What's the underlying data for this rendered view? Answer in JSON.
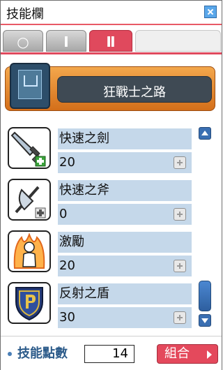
{
  "window": {
    "title": "技能欄"
  },
  "tabs": [
    {
      "glyph": "○",
      "active": false
    },
    {
      "glyph": "Ⅰ",
      "active": false
    },
    {
      "glyph": "Ⅱ",
      "active": true
    },
    {
      "glyph": "",
      "active": false
    }
  ],
  "job": {
    "title": "狂戰士之路",
    "icon": "book-icon"
  },
  "skills": [
    {
      "name": "快速之劍",
      "level": "20",
      "icon": "sword-icon"
    },
    {
      "name": "快速之斧",
      "level": "0",
      "icon": "axe-icon"
    },
    {
      "name": "激勵",
      "level": "20",
      "icon": "rage-icon"
    },
    {
      "name": "反射之盾",
      "level": "30",
      "icon": "shield-icon"
    }
  ],
  "footer": {
    "sp_label": "技能點數",
    "sp_value": "14",
    "combo_label": "組合"
  },
  "colors": {
    "accent_red": "#e0495d",
    "row_blue": "#c5d8ea",
    "scroll_blue": "#3a6fb2",
    "job_orange": "#f3a74c"
  }
}
